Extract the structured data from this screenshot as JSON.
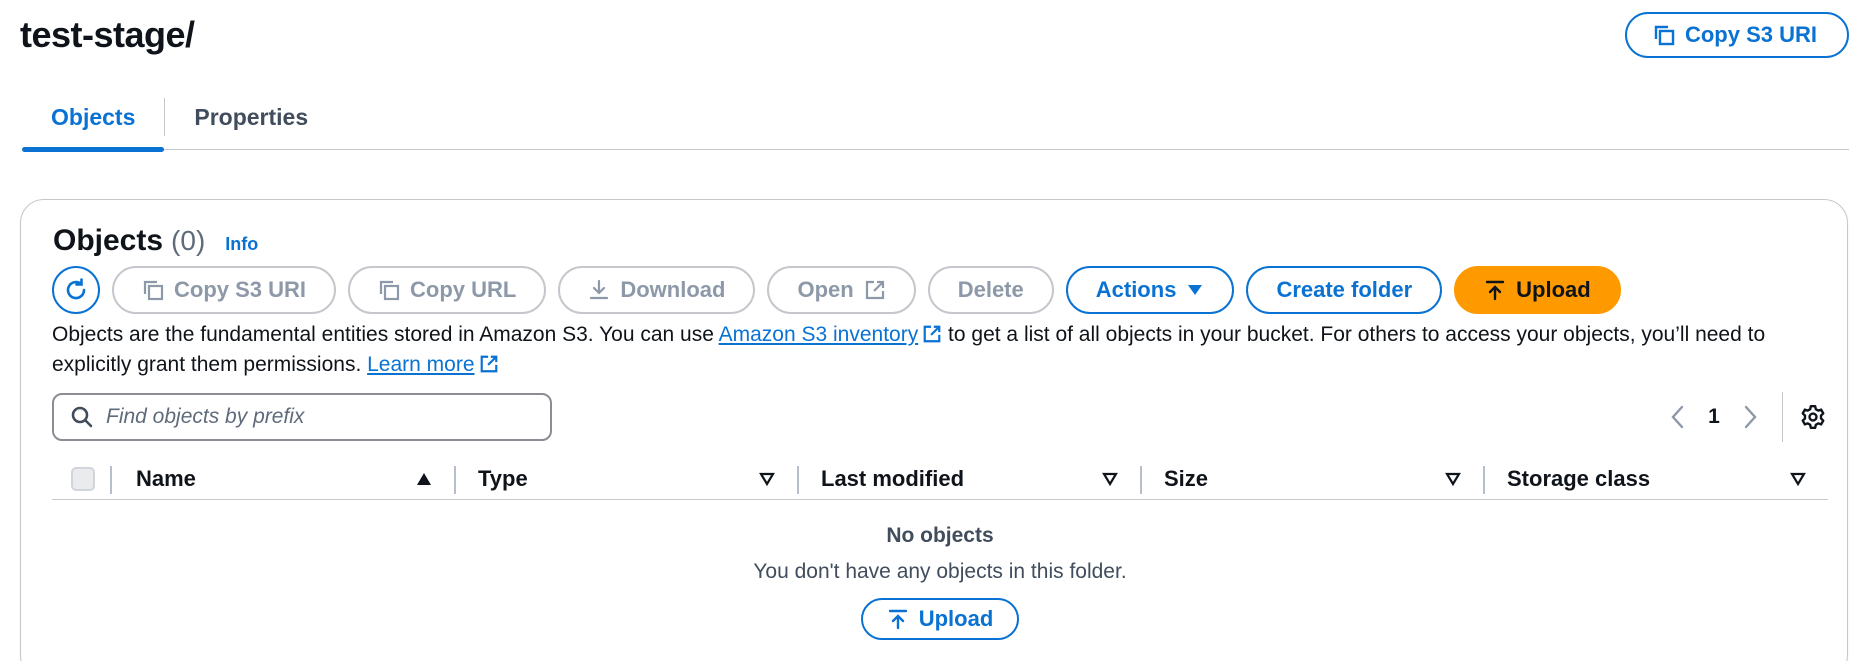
{
  "header": {
    "title": "test-stage/",
    "copy_s3_uri": "Copy S3 URI"
  },
  "tabs": [
    {
      "label": "Objects",
      "active": true
    },
    {
      "label": "Properties",
      "active": false
    }
  ],
  "objects_panel": {
    "title": "Objects",
    "count": "(0)",
    "info": "Info",
    "toolbar": {
      "copy_s3_uri": "Copy S3 URI",
      "copy_url": "Copy URL",
      "download": "Download",
      "open": "Open",
      "delete": "Delete",
      "actions": "Actions",
      "create_folder": "Create folder",
      "upload": "Upload"
    },
    "description": {
      "part1": "Objects are the fundamental entities stored in Amazon S3. You can use ",
      "link1": "Amazon S3 inventory",
      "part2": " to get a list of all objects in your bucket. For others to access your objects, you’ll need to explicitly grant them permissions. ",
      "link2": "Learn more"
    },
    "search": {
      "placeholder": "Find objects by prefix",
      "value": ""
    },
    "pagination": {
      "current_page": "1"
    },
    "table": {
      "columns": [
        {
          "label": "Name",
          "sort": "ascending"
        },
        {
          "label": "Type",
          "sort": "none"
        },
        {
          "label": "Last modified",
          "sort": "none"
        },
        {
          "label": "Size",
          "sort": "none"
        },
        {
          "label": "Storage class",
          "sort": "none"
        }
      ],
      "rows": []
    },
    "empty_state": {
      "title": "No objects",
      "message": "You don't have any objects in this folder.",
      "upload": "Upload"
    }
  },
  "colors": {
    "accent": "#0972d3",
    "upload_orange": "#ff9900",
    "disabled": "#8d99a8",
    "border": "#c6c6cd"
  }
}
